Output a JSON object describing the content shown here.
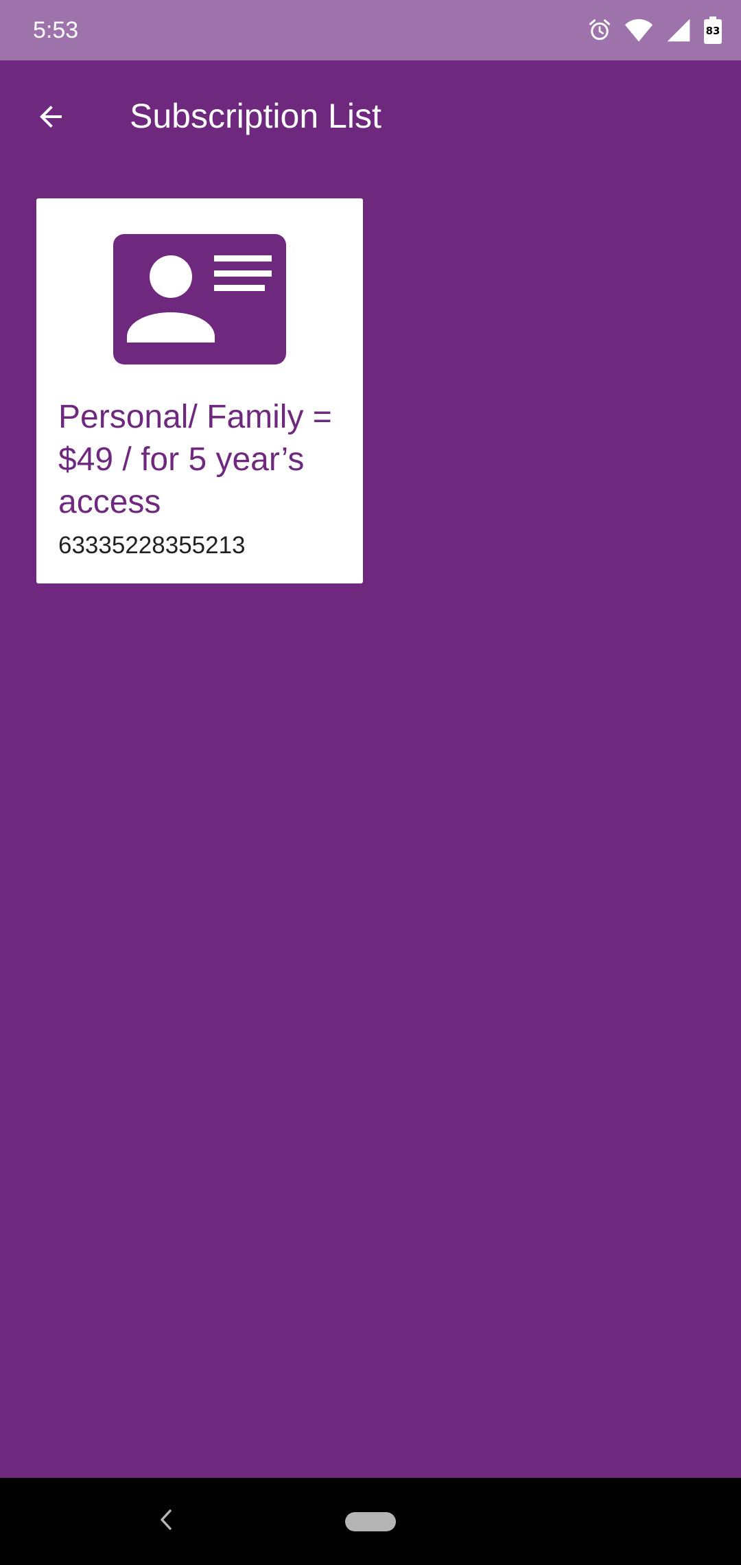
{
  "status_bar": {
    "time": "5:53",
    "battery_level": "83",
    "icons": [
      "alarm-icon",
      "wifi-icon",
      "signal-icon",
      "battery-icon"
    ]
  },
  "app_bar": {
    "title": "Subscription List",
    "back_icon": "arrow-back-icon"
  },
  "subscriptions": [
    {
      "icon": "id-card-icon",
      "title": "Personal/ Family = $49 / for 5 year’s access",
      "number": "63335228355213"
    }
  ],
  "navigation_bar": {
    "icons": [
      "nav-back-icon",
      "nav-home-pill"
    ]
  },
  "colors": {
    "primary": "#6e287e",
    "status_bar": "#9e73ab",
    "card_background": "#ffffff",
    "nav_bar": "#000000"
  }
}
